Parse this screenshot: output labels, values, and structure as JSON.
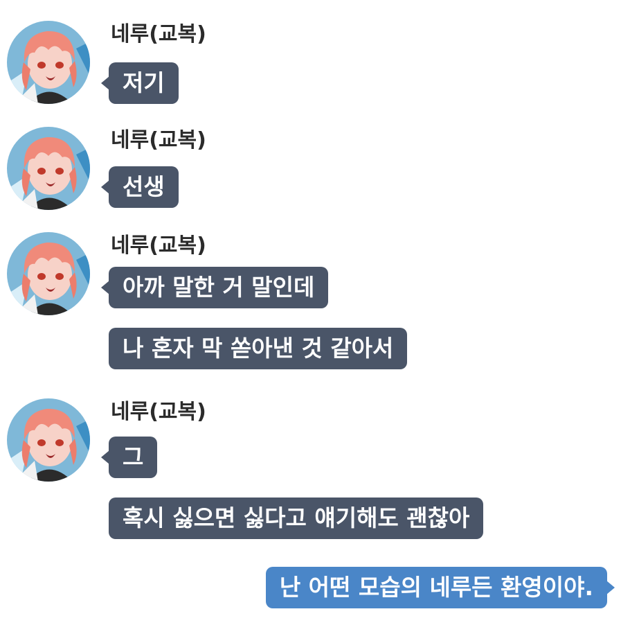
{
  "colors": {
    "incoming_bubble": "#4a5568",
    "outgoing_bubble": "#4a86c8",
    "bubble_text": "#ffffff",
    "sender_name": "#2b2b2b",
    "background": "#ffffff"
  },
  "groups": [
    {
      "sender": "네루(교복)",
      "avatar_icon": "avatar-portrait-icon",
      "messages": [
        "저기"
      ]
    },
    {
      "sender": "네루(교복)",
      "avatar_icon": "avatar-portrait-icon",
      "messages": [
        "선생"
      ]
    },
    {
      "sender": "네루(교복)",
      "avatar_icon": "avatar-portrait-icon",
      "messages": [
        "아까 말한 거 말인데",
        "나 혼자 막 쏟아낸 것 같아서"
      ]
    },
    {
      "sender": "네루(교복)",
      "avatar_icon": "avatar-portrait-icon",
      "messages": [
        "그",
        "혹시 싫으면 싫다고 얘기해도 괜찮아"
      ]
    }
  ],
  "outgoing": {
    "messages": [
      "난 어떤 모습의 네루든 환영이야."
    ]
  }
}
